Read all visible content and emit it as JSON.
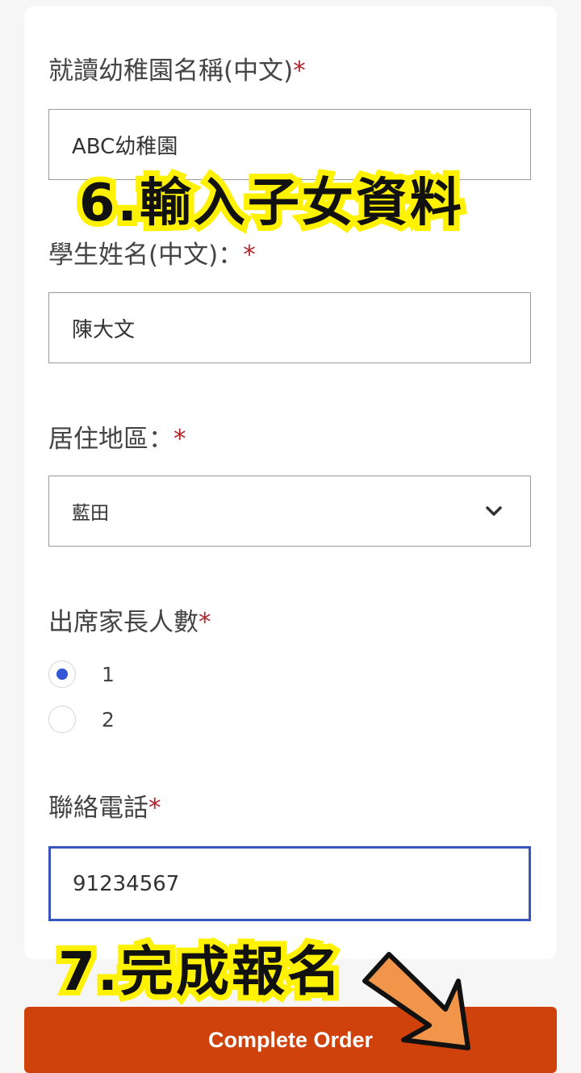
{
  "form": {
    "kindergarten": {
      "label": "就讀幼稚園名稱(中文)",
      "required_mark": "*",
      "value": "ABC幼稚園"
    },
    "student_name": {
      "label": "學生姓名(中文)：",
      "required_mark": "*",
      "value": "陳大文"
    },
    "district": {
      "label": "居住地區：",
      "required_mark": "*",
      "value": "藍田"
    },
    "parents": {
      "label": "出席家長人數",
      "required_mark": "*",
      "options": [
        "1",
        "2"
      ],
      "selected": "1"
    },
    "phone": {
      "label": "聯絡電話",
      "required_mark": "*",
      "value": "91234567"
    }
  },
  "submit_label": "Complete Order",
  "annotations": {
    "step6": "6.輸入子女資料",
    "step7": "7.完成報名"
  },
  "colors": {
    "highlight": "#fff200",
    "button": "#cf420c",
    "arrow": "#f0954a",
    "focus_border": "#3a55b9",
    "radio_selected": "#3256d6",
    "required": "#b0242b"
  },
  "icons": {
    "select": "chevron-down-icon",
    "pointer": "arrow-icon"
  }
}
